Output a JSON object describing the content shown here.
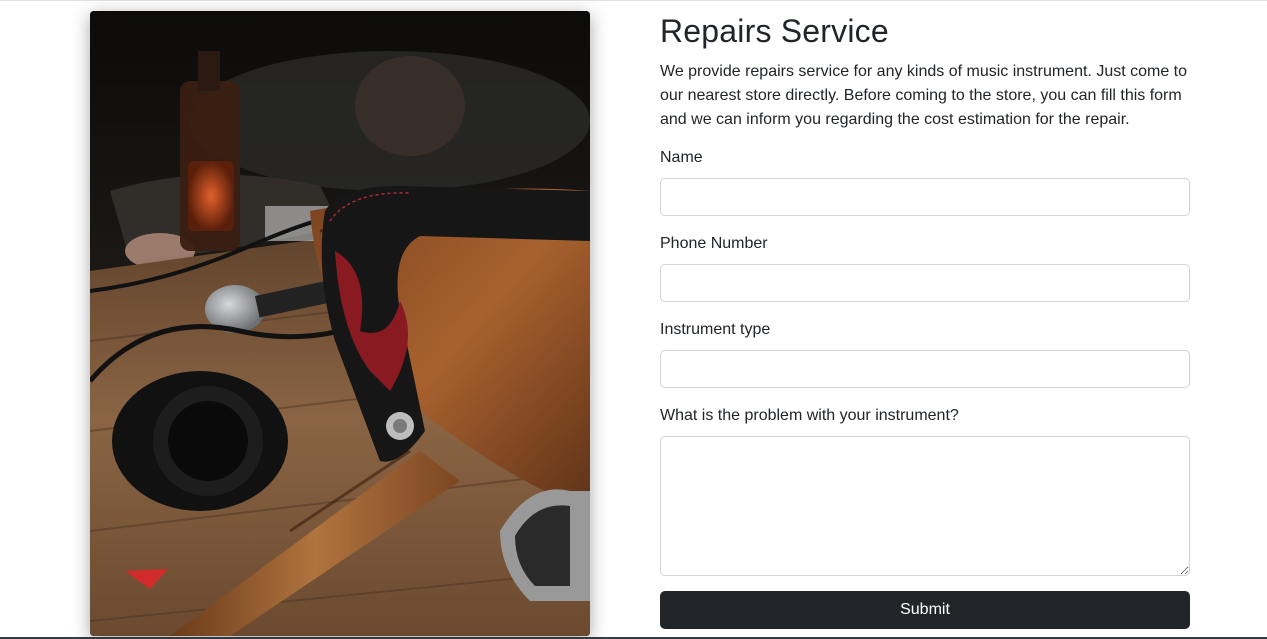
{
  "page": {
    "title": "Repairs Service",
    "description": "We provide repairs service for any kinds of music instrument. Just come to our nearest store directly. Before coming to the store, you can fill this form and we can inform you regarding the cost estimation for the repair."
  },
  "form": {
    "name_label": "Name",
    "name_value": "",
    "phone_label": "Phone Number",
    "phone_value": "",
    "instrument_label": "Instrument type",
    "instrument_value": "",
    "problem_label": "What is the problem with your instrument?",
    "problem_value": "",
    "submit_label": "Submit"
  },
  "colors": {
    "button_bg": "#212529",
    "button_text": "#ffffff",
    "input_border": "#ced4da",
    "text": "#212529"
  }
}
